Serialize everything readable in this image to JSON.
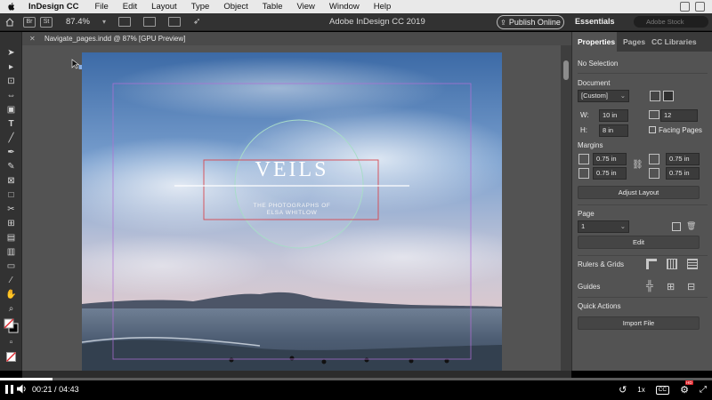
{
  "menubar": {
    "app_name": "InDesign CC",
    "items": [
      "File",
      "Edit",
      "Layout",
      "Type",
      "Object",
      "Table",
      "View",
      "Window",
      "Help"
    ]
  },
  "controlbar": {
    "badge_bridge": "Br",
    "badge_stock": "St",
    "zoom": "87.4%",
    "window_title": "Adobe InDesign CC 2019",
    "publish_label": "Publish Online",
    "workspace_label": "Essentials",
    "stock_search_placeholder": "Adobe Stock"
  },
  "document": {
    "tab_title": "Navigate_pages.indd @ 87% [GPU Preview]",
    "heading": "VEILS",
    "subtitle_line1": "THE PHOTOGRAPHS OF",
    "subtitle_line2": "ELSA WHITLOW"
  },
  "panel": {
    "tabs": [
      "Properties",
      "Pages",
      "CC Libraries"
    ],
    "selection": "No Selection",
    "document_label": "Document",
    "preset": "[Custom]",
    "width_label": "W:",
    "width": "10 in",
    "height_label": "H:",
    "height": "8 in",
    "pages_count": "12",
    "facing_pages_label": "Facing Pages",
    "margins_label": "Margins",
    "margin_top": "0.75 in",
    "margin_bottom": "0.75 in",
    "margin_left": "0.75 in",
    "margin_right": "0.75 in",
    "adjust_layout_label": "Adjust Layout",
    "page_label": "Page",
    "page_value": "1",
    "edit_label": "Edit",
    "rulers_grids_label": "Rulers & Grids",
    "guides_label": "Guides",
    "quick_actions_label": "Quick Actions",
    "import_file_label": "Import File"
  },
  "player": {
    "current_time": "00:21",
    "time_separator": "/",
    "total_time": "04:43",
    "progress": 0.074,
    "speed": "1x",
    "cc_label": "CC",
    "hd_badge": "HD"
  }
}
